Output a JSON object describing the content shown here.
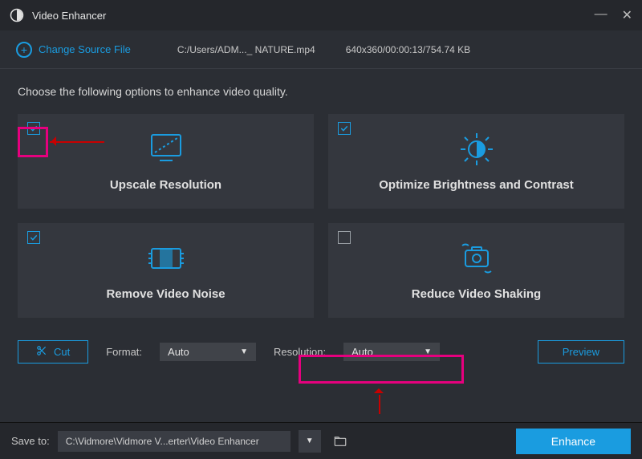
{
  "app": {
    "title": "Video Enhancer"
  },
  "toolbar": {
    "change_source_label": "Change Source File",
    "file_path": "C:/Users/ADM..._ NATURE.mp4",
    "file_meta": "640x360/00:00:13/754.74 KB"
  },
  "main": {
    "subtitle": "Choose the following options to enhance video quality."
  },
  "options": [
    {
      "id": "upscale",
      "label": "Upscale Resolution",
      "checked": true
    },
    {
      "id": "brightness",
      "label": "Optimize Brightness and Contrast",
      "checked": true
    },
    {
      "id": "noise",
      "label": "Remove Video Noise",
      "checked": true
    },
    {
      "id": "shaking",
      "label": "Reduce Video Shaking",
      "checked": false
    }
  ],
  "controls": {
    "cut_label": "Cut",
    "format_label": "Format:",
    "format_value": "Auto",
    "resolution_label": "Resolution:",
    "resolution_value": "Auto",
    "preview_label": "Preview"
  },
  "bottom": {
    "save_label": "Save to:",
    "save_path": "C:\\Vidmore\\Vidmore V...erter\\Video Enhancer",
    "enhance_label": "Enhance"
  },
  "colors": {
    "accent": "#1a9ce0",
    "annotation": "#e6007e"
  }
}
